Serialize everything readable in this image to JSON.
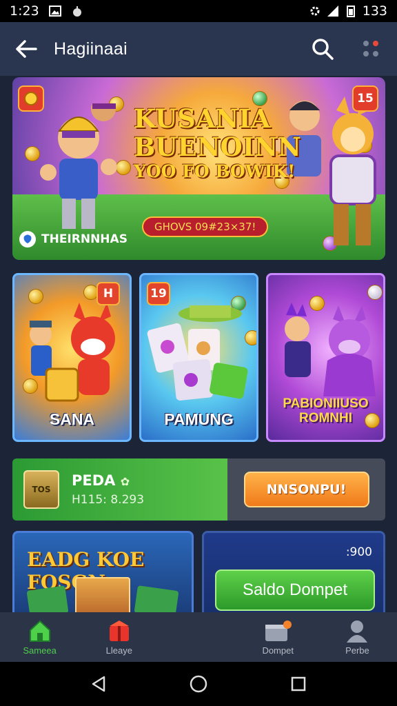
{
  "status_bar": {
    "time": "1:23",
    "battery": "133"
  },
  "app_bar": {
    "title": "Hagiinaai"
  },
  "hero": {
    "badge_left": "",
    "badge_right": "15",
    "title_line1": "KUSANIA",
    "title_line2": "BUENOINN",
    "title_line3": "YOO FO BOWIK!",
    "cta": "GHOVS 09#23×37!",
    "brand": "THEIRNNHAS"
  },
  "game_cards": [
    {
      "badge": "H",
      "title": "SANA"
    },
    {
      "badge": "19",
      "title": "PAMUNG"
    },
    {
      "badge": "",
      "title_line1": "PABIONIIUSO",
      "title_line2": "ROMNHI"
    }
  ],
  "promo": {
    "gift_label": "TOS",
    "name": "PEDA",
    "meta": "H115: 8.293",
    "button": "NNSONPU!"
  },
  "bottom_left": {
    "title": "EADG KOE FOSGN"
  },
  "bottom_right": {
    "amount": ":900",
    "button": "Saldo Dompet"
  },
  "bottom_nav": [
    {
      "label": "Sameea",
      "icon": "home-icon"
    },
    {
      "label": "Lleaye",
      "icon": "gift-icon"
    },
    {
      "label": "",
      "icon": ""
    },
    {
      "label": "Dompet",
      "icon": "wallet-icon"
    },
    {
      "label": "Perbe",
      "icon": "profile-icon"
    }
  ],
  "colors": {
    "accent_green": "#4fd04a",
    "orange": "#f07a1a",
    "app_bar": "#2a3550"
  }
}
